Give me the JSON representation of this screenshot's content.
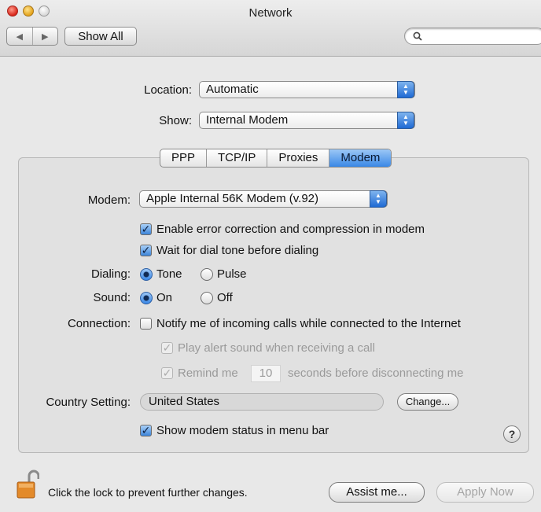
{
  "window": {
    "title": "Network"
  },
  "toolbar": {
    "back_glyph": "◀",
    "forward_glyph": "▶",
    "show_all": "Show All",
    "search_icon": "search-icon",
    "search_value": ""
  },
  "location": {
    "label": "Location:",
    "value": "Automatic"
  },
  "show": {
    "label": "Show:",
    "value": "Internal Modem"
  },
  "tabs": [
    {
      "label": "PPP",
      "active": false
    },
    {
      "label": "TCP/IP",
      "active": false
    },
    {
      "label": "Proxies",
      "active": false
    },
    {
      "label": "Modem",
      "active": true
    }
  ],
  "modem": {
    "label": "Modem:",
    "value": "Apple Internal 56K Modem (v.92)",
    "error_correction": {
      "label": "Enable error correction and compression in modem",
      "checked": true
    },
    "wait_dial_tone": {
      "label": "Wait for dial tone before dialing",
      "checked": true
    },
    "dialing": {
      "label": "Dialing:",
      "options": [
        "Tone",
        "Pulse"
      ],
      "selected": "Tone"
    },
    "sound": {
      "label": "Sound:",
      "options": [
        "On",
        "Off"
      ],
      "selected": "On"
    },
    "connection": {
      "label": "Connection:",
      "notify": {
        "label": "Notify me of incoming calls while connected to the Internet",
        "checked": false
      },
      "play_alert": {
        "label": "Play alert sound when receiving a call",
        "checked": true,
        "enabled": false
      },
      "remind": {
        "prefix": "Remind me",
        "seconds": "10",
        "suffix": "seconds before disconnecting me",
        "checked": true,
        "enabled": false
      }
    },
    "country": {
      "label": "Country Setting:",
      "value": "United States",
      "change_button": "Change..."
    },
    "show_status": {
      "label": "Show modem status in menu bar",
      "checked": true
    },
    "help": "?"
  },
  "footer": {
    "lock_text": "Click the lock to prevent further changes.",
    "assist_button": "Assist me...",
    "apply_button": "Apply Now"
  },
  "colors": {
    "accent": "#3a88e6",
    "lock": "#e38a2a"
  }
}
